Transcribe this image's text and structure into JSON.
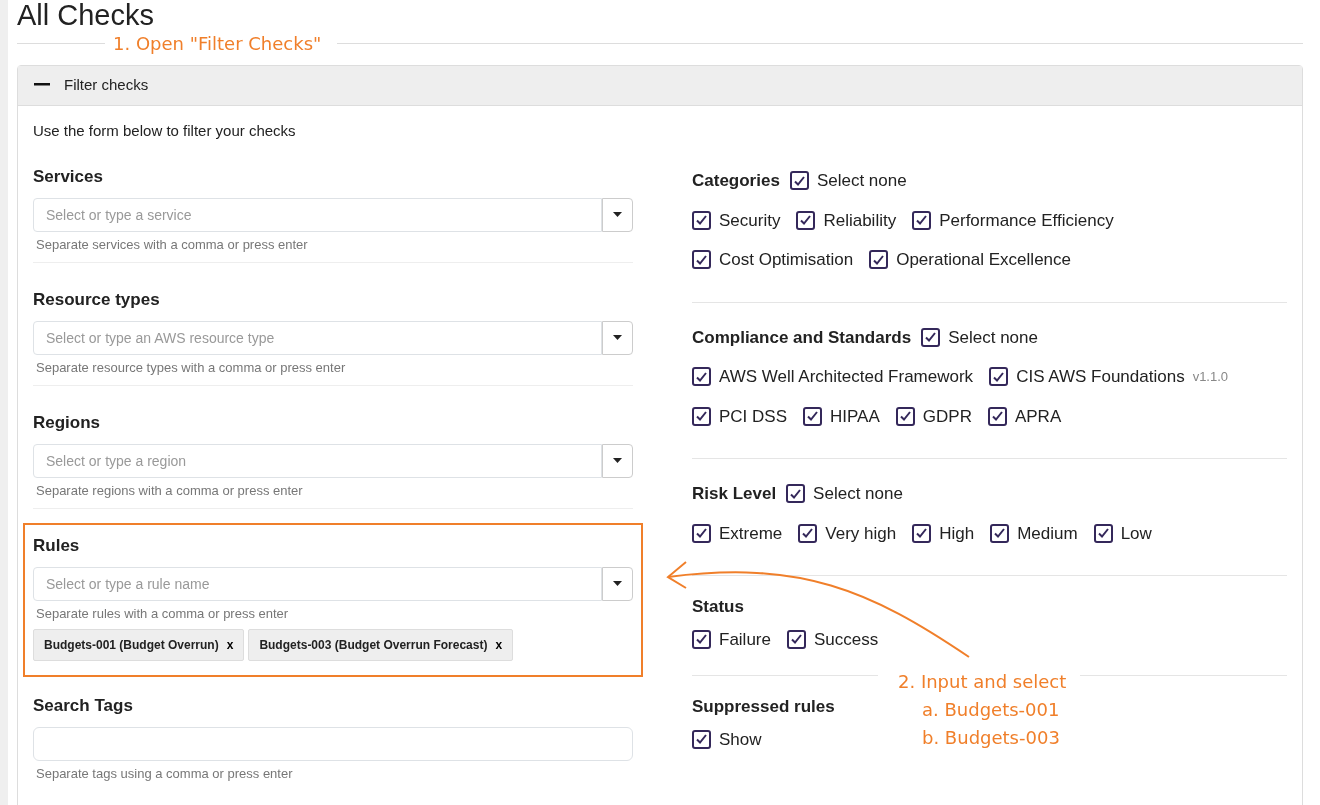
{
  "page": {
    "title": "All Checks"
  },
  "annotations": [
    {
      "kind": "divider-callout",
      "lines": [
        "1. Open \"Filter Checks\""
      ]
    },
    {
      "kind": "arrow-callout",
      "lines": [
        "2. Input and select",
        "a. Budgets-001",
        "b. Budgets-003"
      ]
    }
  ],
  "filter_panel": {
    "title": "Filter checks",
    "expanded": true,
    "intro": "Use the form below to filter your checks",
    "fields": [
      {
        "kind": "select",
        "label": "Services",
        "placeholder": "Select or type a service",
        "help": "Separate services with a comma or press enter",
        "highlighted": false
      },
      {
        "kind": "select",
        "label": "Resource types",
        "placeholder": "Select or type an AWS resource type",
        "help": "Separate resource types with a comma or press enter",
        "highlighted": false
      },
      {
        "kind": "select",
        "label": "Regions",
        "placeholder": "Select or type a region",
        "help": "Separate regions with a comma or press enter",
        "highlighted": false
      },
      {
        "kind": "select",
        "label": "Rules",
        "placeholder": "Select or type a rule name",
        "help": "Separate rules with a comma or press enter",
        "highlighted": true,
        "tags": [
          {
            "label": "Budgets-001 (Budget Overrun)",
            "remove": "x"
          },
          {
            "label": "Budgets-003 (Budget Overrun Forecast)",
            "remove": "x"
          }
        ]
      },
      {
        "kind": "text",
        "label": "Search Tags",
        "help": "Separate tags using a comma or press enter",
        "highlighted": false
      }
    ],
    "groups": [
      {
        "title": "Categories",
        "select_all": {
          "label": "Select none",
          "checked": true
        },
        "options": [
          {
            "label": "Security",
            "checked": true
          },
          {
            "label": "Reliability",
            "checked": true
          },
          {
            "label": "Performance Efficiency",
            "checked": true
          },
          {
            "label": "Cost Optimisation",
            "checked": true
          },
          {
            "label": "Operational Excellence",
            "checked": true
          }
        ]
      },
      {
        "title": "Compliance and Standards",
        "select_all": {
          "label": "Select none",
          "checked": true
        },
        "options": [
          {
            "label": "AWS Well Architected Framework",
            "checked": true
          },
          {
            "label": "CIS AWS Foundations",
            "version": "v1.1.0",
            "checked": true
          },
          {
            "label": "PCI DSS",
            "checked": true
          },
          {
            "label": "HIPAA",
            "checked": true
          },
          {
            "label": "GDPR",
            "checked": true
          },
          {
            "label": "APRA",
            "checked": true
          }
        ]
      },
      {
        "title": "Risk Level",
        "select_all": {
          "label": "Select none",
          "checked": true
        },
        "options": [
          {
            "label": "Extreme",
            "checked": true
          },
          {
            "label": "Very high",
            "checked": true
          },
          {
            "label": "High",
            "checked": true
          },
          {
            "label": "Medium",
            "checked": true
          },
          {
            "label": "Low",
            "checked": true
          }
        ]
      },
      {
        "title": "Status",
        "options": [
          {
            "label": "Failure",
            "checked": true
          },
          {
            "label": "Success",
            "checked": true
          }
        ]
      },
      {
        "title": "Suppressed rules",
        "options": [
          {
            "label": "Show",
            "checked": true
          }
        ]
      }
    ]
  }
}
